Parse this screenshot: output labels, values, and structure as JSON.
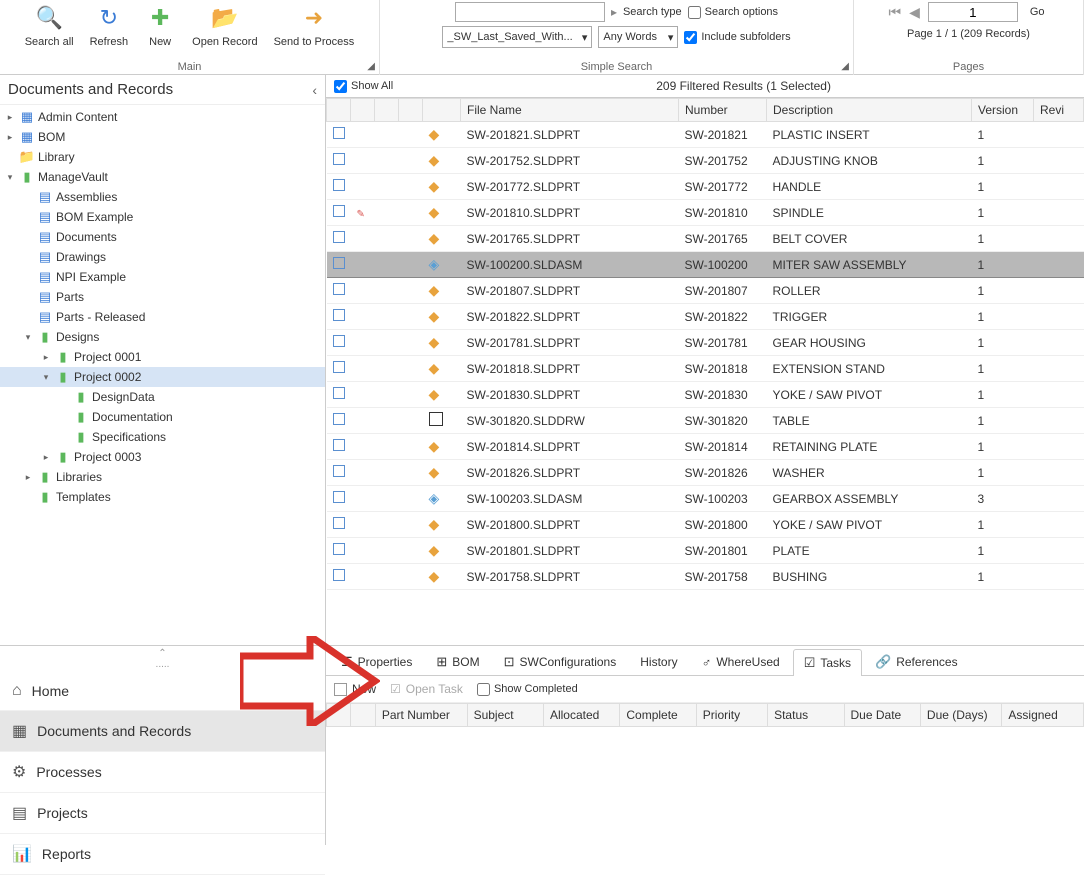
{
  "ribbon": {
    "main": {
      "label": "Main",
      "search_all": "Search all",
      "refresh": "Refresh",
      "new": "New",
      "open_record": "Open Record",
      "send_to_process": "Send to Process"
    },
    "search": {
      "label": "Simple Search",
      "input_value": "",
      "type_label": "Search type",
      "options_label": "Search options",
      "saved_dd": "_SW_Last_Saved_With...",
      "words_dd": "Any Words",
      "include_sub": "Include subfolders"
    },
    "pages": {
      "label": "Pages",
      "page_input": "1",
      "go": "Go",
      "status": "Page 1 / 1 (209 Records)"
    }
  },
  "nav": {
    "title": "Documents and Records"
  },
  "tree": [
    {
      "depth": 0,
      "toggle": "▸",
      "icon": "grid",
      "label": "Admin Content"
    },
    {
      "depth": 0,
      "toggle": "▸",
      "icon": "grid",
      "label": "BOM"
    },
    {
      "depth": 0,
      "toggle": "",
      "icon": "folder",
      "label": "Library"
    },
    {
      "depth": 0,
      "toggle": "▾",
      "icon": "green",
      "label": "ManageVault"
    },
    {
      "depth": 1,
      "toggle": "",
      "icon": "doc",
      "label": "Assemblies"
    },
    {
      "depth": 1,
      "toggle": "",
      "icon": "doc",
      "label": "BOM Example"
    },
    {
      "depth": 1,
      "toggle": "",
      "icon": "doc",
      "label": "Documents"
    },
    {
      "depth": 1,
      "toggle": "",
      "icon": "doc",
      "label": "Drawings"
    },
    {
      "depth": 1,
      "toggle": "",
      "icon": "doc",
      "label": "NPI Example"
    },
    {
      "depth": 1,
      "toggle": "",
      "icon": "doc",
      "label": "Parts"
    },
    {
      "depth": 1,
      "toggle": "",
      "icon": "doc",
      "label": "Parts - Released"
    },
    {
      "depth": 1,
      "toggle": "▾",
      "icon": "green",
      "label": "Designs"
    },
    {
      "depth": 2,
      "toggle": "▸",
      "icon": "green",
      "label": "Project 0001"
    },
    {
      "depth": 2,
      "toggle": "▾",
      "icon": "green",
      "label": "Project 0002",
      "selected": true
    },
    {
      "depth": 3,
      "toggle": "",
      "icon": "green",
      "label": "DesignData"
    },
    {
      "depth": 3,
      "toggle": "",
      "icon": "green",
      "label": "Documentation"
    },
    {
      "depth": 3,
      "toggle": "",
      "icon": "green",
      "label": "Specifications"
    },
    {
      "depth": 2,
      "toggle": "▸",
      "icon": "green",
      "label": "Project 0003"
    },
    {
      "depth": 1,
      "toggle": "▸",
      "icon": "green",
      "label": "Libraries"
    },
    {
      "depth": 1,
      "toggle": "",
      "icon": "green",
      "label": "Templates"
    }
  ],
  "grid": {
    "show_all": "Show All",
    "results": "209 Filtered Results   (1 Selected)",
    "cols": [
      "",
      "",
      "",
      "",
      "",
      "File Name",
      "Number",
      "Description",
      "Version",
      "Revi"
    ],
    "rows": [
      {
        "icon": "prt",
        "file": "SW-201821.SLDPRT",
        "num": "SW-201821",
        "desc": "PLASTIC INSERT",
        "ver": "1"
      },
      {
        "icon": "prt",
        "file": "SW-201752.SLDPRT",
        "num": "SW-201752",
        "desc": "ADJUSTING KNOB",
        "ver": "1"
      },
      {
        "icon": "prt",
        "file": "SW-201772.SLDPRT",
        "num": "SW-201772",
        "desc": "HANDLE",
        "ver": "1"
      },
      {
        "icon": "prt",
        "file": "SW-201810.SLDPRT",
        "num": "SW-201810",
        "desc": "SPINDLE",
        "ver": "1",
        "flag": true
      },
      {
        "icon": "prt",
        "file": "SW-201765.SLDPRT",
        "num": "SW-201765",
        "desc": "BELT COVER",
        "ver": "1"
      },
      {
        "icon": "asm",
        "file": "SW-100200.SLDASM",
        "num": "SW-100200",
        "desc": "MITER SAW ASSEMBLY",
        "ver": "1",
        "selected": true
      },
      {
        "icon": "prt",
        "file": "SW-201807.SLDPRT",
        "num": "SW-201807",
        "desc": "ROLLER",
        "ver": "1"
      },
      {
        "icon": "prt",
        "file": "SW-201822.SLDPRT",
        "num": "SW-201822",
        "desc": "TRIGGER",
        "ver": "1"
      },
      {
        "icon": "prt",
        "file": "SW-201781.SLDPRT",
        "num": "SW-201781",
        "desc": "GEAR HOUSING",
        "ver": "1"
      },
      {
        "icon": "prt",
        "file": "SW-201818.SLDPRT",
        "num": "SW-201818",
        "desc": "EXTENSION STAND",
        "ver": "1"
      },
      {
        "icon": "prt",
        "file": "SW-201830.SLDPRT",
        "num": "SW-201830",
        "desc": "YOKE / SAW PIVOT",
        "ver": "1"
      },
      {
        "icon": "drw",
        "file": "SW-301820.SLDDRW",
        "num": "SW-301820",
        "desc": "TABLE",
        "ver": "1"
      },
      {
        "icon": "prt",
        "file": "SW-201814.SLDPRT",
        "num": "SW-201814",
        "desc": "RETAINING PLATE",
        "ver": "1"
      },
      {
        "icon": "prt",
        "file": "SW-201826.SLDPRT",
        "num": "SW-201826",
        "desc": "WASHER",
        "ver": "1"
      },
      {
        "icon": "asm",
        "file": "SW-100203.SLDASM",
        "num": "SW-100203",
        "desc": "GEARBOX ASSEMBLY",
        "ver": "3"
      },
      {
        "icon": "prt",
        "file": "SW-201800.SLDPRT",
        "num": "SW-201800",
        "desc": "YOKE / SAW PIVOT",
        "ver": "1"
      },
      {
        "icon": "prt",
        "file": "SW-201801.SLDPRT",
        "num": "SW-201801",
        "desc": "PLATE",
        "ver": "1"
      },
      {
        "icon": "prt",
        "file": "SW-201758.SLDPRT",
        "num": "SW-201758",
        "desc": "BUSHING",
        "ver": "1"
      }
    ]
  },
  "sidenav": [
    {
      "icon": "⌂",
      "label": "Home"
    },
    {
      "icon": "▦",
      "label": "Documents and Records",
      "active": true
    },
    {
      "icon": "⚙",
      "label": "Processes"
    },
    {
      "icon": "▤",
      "label": "Projects"
    },
    {
      "icon": "📊",
      "label": "Reports"
    }
  ],
  "tabs": [
    {
      "icon": "☰",
      "label": "Properties"
    },
    {
      "icon": "⊞",
      "label": "BOM"
    },
    {
      "icon": "⊡",
      "label": "SWConfigurations"
    },
    {
      "icon": "",
      "label": "History"
    },
    {
      "icon": "♂",
      "label": "WhereUsed"
    },
    {
      "icon": "☑",
      "label": "Tasks",
      "active": true
    },
    {
      "icon": "🔗",
      "label": "References"
    }
  ],
  "tasks": {
    "new": "New",
    "open": "Open Task",
    "show_completed": "Show Completed",
    "cols": [
      "",
      "",
      "Part Number",
      "Subject",
      "Allocated",
      "Complete",
      "Priority",
      "Status",
      "Due Date",
      "Due (Days)",
      "Assigned"
    ]
  }
}
